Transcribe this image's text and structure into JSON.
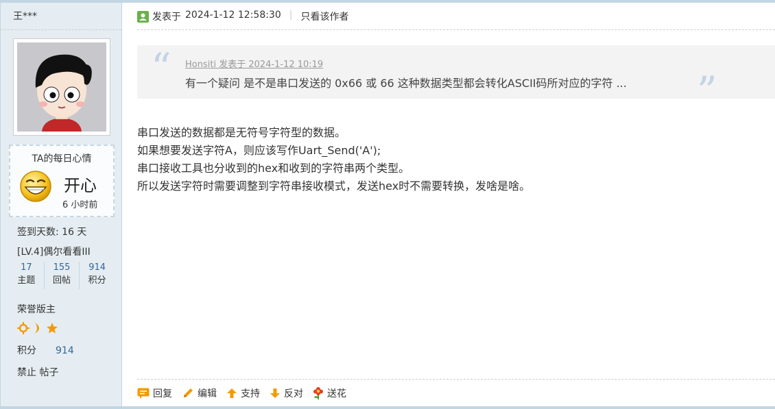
{
  "user": {
    "name": "王***",
    "mood": {
      "title": "TA的每日心情",
      "text": "开心",
      "time": "6 小时前"
    },
    "checkin": "签到天数: 16 天",
    "level": "[LV.4]偶尔看看III",
    "stats": [
      {
        "num": "17",
        "label": "主题"
      },
      {
        "num": "155",
        "label": "回帖"
      },
      {
        "num": "914",
        "label": "积分"
      }
    ],
    "honor": "荣誉版主",
    "points_label": "积分",
    "points_value": "914",
    "links": "禁止 帖子"
  },
  "post": {
    "posted_label": "发表于",
    "posted_time": "2024-1-12 12:58:30",
    "separator": "|",
    "only_author": "只看该作者",
    "quote": {
      "author_line": "Honsiti 发表于 2024-1-12 10:19",
      "text": "有一个疑问  是不是串口发送的  0x66 或  66 这种数据类型都会转化ASCII码所对应的字符 ..."
    },
    "lines": [
      "串口发送的数据都是无符号字符型的数据。",
      "如果想要发送字符A，则应该写作Uart_Send('A');",
      "串口接收工具也分收到的hex和收到的字符串两个类型。",
      "所以发送字符时需要调整到字符串接收模式，发送hex时不需要转换，发啥是啥。"
    ]
  },
  "actions": {
    "reply": "回复",
    "edit": "编辑",
    "support": "支持",
    "oppose": "反对",
    "flower": "送花"
  },
  "colors": {
    "sidebar_bg": "#e5edf2",
    "link_blue": "#336699",
    "action_orange": "#f29b00"
  }
}
